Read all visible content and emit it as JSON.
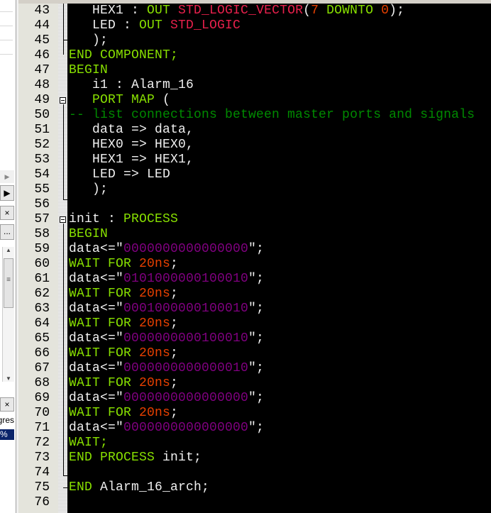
{
  "left_panel": {
    "close_label": "×",
    "close2_label": "×",
    "ellipsis_label": "...",
    "progress_header": "gres",
    "progress_value": "%"
  },
  "colors": {
    "background": "#000000",
    "keyword": "#88e000",
    "type": "#e8204c",
    "number": "#e84000",
    "comment": "#008a00",
    "string": "#800080",
    "identifier": "#f0f0f0"
  },
  "editor": {
    "lines": [
      {
        "n": "43",
        "tokens": [
          [
            "   HEX1 : ",
            "id"
          ],
          [
            "OUT ",
            "kw"
          ],
          [
            "STD_LOGIC_VECTOR",
            "ty"
          ],
          [
            "(",
            "id"
          ],
          [
            "7 ",
            "num"
          ],
          [
            "DOWNTO ",
            "kw"
          ],
          [
            "0",
            "num"
          ],
          [
            ");",
            "id"
          ]
        ]
      },
      {
        "n": "44",
        "tokens": [
          [
            "   LED : ",
            "id"
          ],
          [
            "OUT ",
            "kw"
          ],
          [
            "STD_LOGIC",
            "ty"
          ]
        ]
      },
      {
        "n": "45",
        "tokens": [
          [
            "   );",
            "id"
          ]
        ]
      },
      {
        "n": "46",
        "tokens": [
          [
            "END COMPONENT;",
            "kw"
          ]
        ]
      },
      {
        "n": "47",
        "tokens": [
          [
            "BEGIN",
            "kw"
          ]
        ]
      },
      {
        "n": "48",
        "tokens": [
          [
            "   i1 : Alarm_16",
            "id"
          ]
        ]
      },
      {
        "n": "49",
        "tokens": [
          [
            "   PORT MAP ",
            "kw"
          ],
          [
            "(",
            "id"
          ]
        ]
      },
      {
        "n": "50",
        "tokens": [
          [
            "-- list connections between master ports and signals",
            "cm"
          ]
        ]
      },
      {
        "n": "51",
        "tokens": [
          [
            "   data => data,",
            "id"
          ]
        ]
      },
      {
        "n": "52",
        "tokens": [
          [
            "   HEX0 => HEX0,",
            "id"
          ]
        ]
      },
      {
        "n": "53",
        "tokens": [
          [
            "   HEX1 => HEX1,",
            "id"
          ]
        ]
      },
      {
        "n": "54",
        "tokens": [
          [
            "   LED => LED",
            "id"
          ]
        ]
      },
      {
        "n": "55",
        "tokens": [
          [
            "   );",
            "id"
          ]
        ]
      },
      {
        "n": "56",
        "tokens": []
      },
      {
        "n": "57",
        "tokens": [
          [
            "init : ",
            "id"
          ],
          [
            "PROCESS",
            "kw"
          ]
        ]
      },
      {
        "n": "58",
        "tokens": [
          [
            "BEGIN",
            "kw"
          ]
        ]
      },
      {
        "n": "59",
        "tokens": [
          [
            "data<=\"",
            "id"
          ],
          [
            "0000000000000000",
            "str"
          ],
          [
            "\";",
            "id"
          ]
        ]
      },
      {
        "n": "60",
        "tokens": [
          [
            "WAIT FOR ",
            "kw"
          ],
          [
            "20ns",
            "num"
          ],
          [
            ";",
            "id"
          ]
        ]
      },
      {
        "n": "61",
        "tokens": [
          [
            "data<=\"",
            "id"
          ],
          [
            "0101000000100010",
            "str"
          ],
          [
            "\";",
            "id"
          ]
        ]
      },
      {
        "n": "62",
        "tokens": [
          [
            "WAIT FOR ",
            "kw"
          ],
          [
            "20ns",
            "num"
          ],
          [
            ";",
            "id"
          ]
        ]
      },
      {
        "n": "63",
        "tokens": [
          [
            "data<=\"",
            "id"
          ],
          [
            "0001000000100010",
            "str"
          ],
          [
            "\";",
            "id"
          ]
        ]
      },
      {
        "n": "64",
        "tokens": [
          [
            "WAIT FOR ",
            "kw"
          ],
          [
            "20ns",
            "num"
          ],
          [
            ";",
            "id"
          ]
        ]
      },
      {
        "n": "65",
        "tokens": [
          [
            "data<=\"",
            "id"
          ],
          [
            "0000000000100010",
            "str"
          ],
          [
            "\";",
            "id"
          ]
        ]
      },
      {
        "n": "66",
        "tokens": [
          [
            "WAIT FOR ",
            "kw"
          ],
          [
            "20ns",
            "num"
          ],
          [
            ";",
            "id"
          ]
        ]
      },
      {
        "n": "67",
        "tokens": [
          [
            "data<=\"",
            "id"
          ],
          [
            "0000000000000010",
            "str"
          ],
          [
            "\";",
            "id"
          ]
        ]
      },
      {
        "n": "68",
        "tokens": [
          [
            "WAIT FOR ",
            "kw"
          ],
          [
            "20ns",
            "num"
          ],
          [
            ";",
            "id"
          ]
        ]
      },
      {
        "n": "69",
        "tokens": [
          [
            "data<=\"",
            "id"
          ],
          [
            "0000000000000000",
            "str"
          ],
          [
            "\";",
            "id"
          ]
        ]
      },
      {
        "n": "70",
        "tokens": [
          [
            "WAIT FOR ",
            "kw"
          ],
          [
            "20ns",
            "num"
          ],
          [
            ";",
            "id"
          ]
        ]
      },
      {
        "n": "71",
        "tokens": [
          [
            "data<=\"",
            "id"
          ],
          [
            "0000000000000000",
            "str"
          ],
          [
            "\";",
            "id"
          ]
        ]
      },
      {
        "n": "72",
        "tokens": [
          [
            "WAIT;",
            "kw"
          ]
        ]
      },
      {
        "n": "73",
        "tokens": [
          [
            "END PROCESS ",
            "kw"
          ],
          [
            "init;",
            "id"
          ]
        ]
      },
      {
        "n": "74",
        "tokens": []
      },
      {
        "n": "75",
        "tokens": [
          [
            "END ",
            "kw"
          ],
          [
            "Alarm_16_arch;",
            "id"
          ]
        ]
      },
      {
        "n": "76",
        "tokens": []
      }
    ]
  }
}
